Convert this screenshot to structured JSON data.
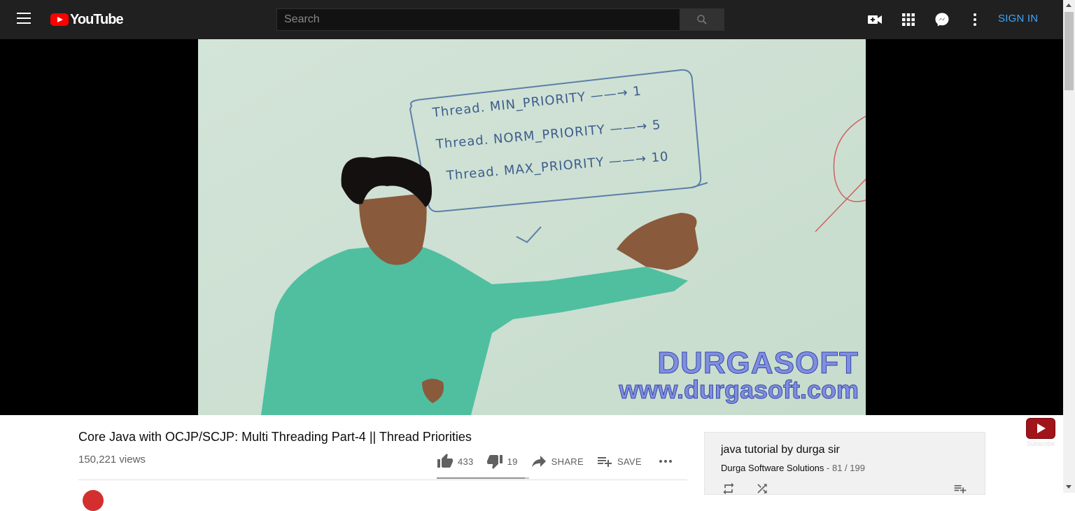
{
  "header": {
    "logo_text": "YouTube",
    "search_placeholder": "Search",
    "sign_in_label": "SIGN IN",
    "icons": [
      "menu-icon",
      "search-icon",
      "video-camera-icon",
      "apps-grid-icon",
      "messages-icon",
      "more-vert-icon"
    ]
  },
  "player": {
    "whiteboard": {
      "line1": "Thread. MIN_PRIORITY ——→ 1",
      "line2": "Thread. NORM_PRIORITY ——→ 5",
      "line3": "Thread. MAX_PRIORITY ——→ 10"
    },
    "watermark_title": "DURGASOFT",
    "watermark_url": "www.durgasoft.com",
    "subscribe_label": "Subscribe"
  },
  "video": {
    "title": "Core Java with OCJP/SCJP: Multi Threading Part-4 || Thread Priorities",
    "views": "150,221 views",
    "likes": "433",
    "dislikes": "19",
    "share_label": "SHARE",
    "save_label": "SAVE",
    "like_ratio": 0.958
  },
  "playlist": {
    "title": "java tutorial by durga sir",
    "owner": "Durga Software Solutions",
    "position": " - 81 / 199"
  },
  "colors": {
    "topbar_bg": "#202020",
    "accent_red": "#ff0000",
    "signin_blue": "#3ea6ff"
  }
}
